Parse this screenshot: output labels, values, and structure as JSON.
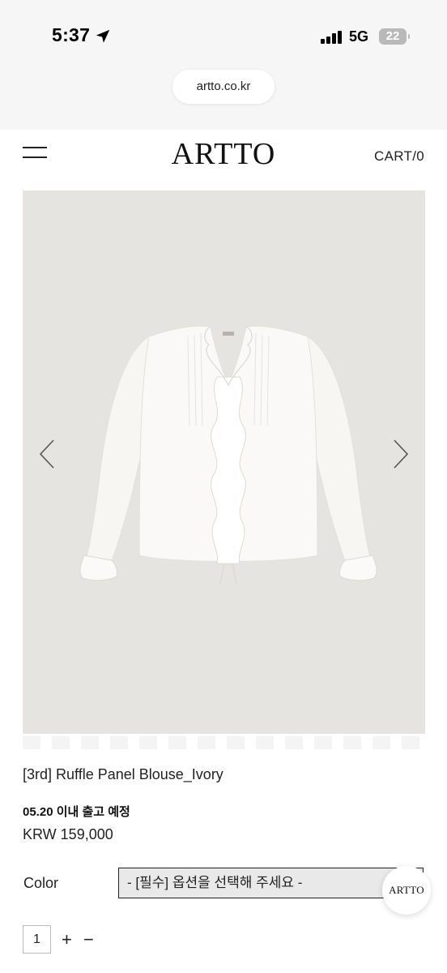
{
  "status_bar": {
    "time": "5:37",
    "network": "5G",
    "battery": "22"
  },
  "browser": {
    "url": "artto.co.kr"
  },
  "header": {
    "logo": "ARTTO",
    "cart": "CART/0",
    "menu_icon": "hamburger-menu-icon"
  },
  "gallery": {
    "prev_icon": "chevron-left-icon",
    "next_icon": "chevron-right-icon",
    "background_color": "#e6e4e1"
  },
  "product": {
    "name": "[3rd] Ruffle Panel Blouse_Ivory",
    "ship_note": "05.20 이내 출고 예정",
    "price": "KRW 159,000",
    "color_label": "Color",
    "color_select_value": "- [필수] 옵션을 선택해 주세요 -",
    "quantity": "1",
    "plus": "+",
    "minus": "−"
  },
  "floating_button": {
    "label": "ARTTO"
  }
}
